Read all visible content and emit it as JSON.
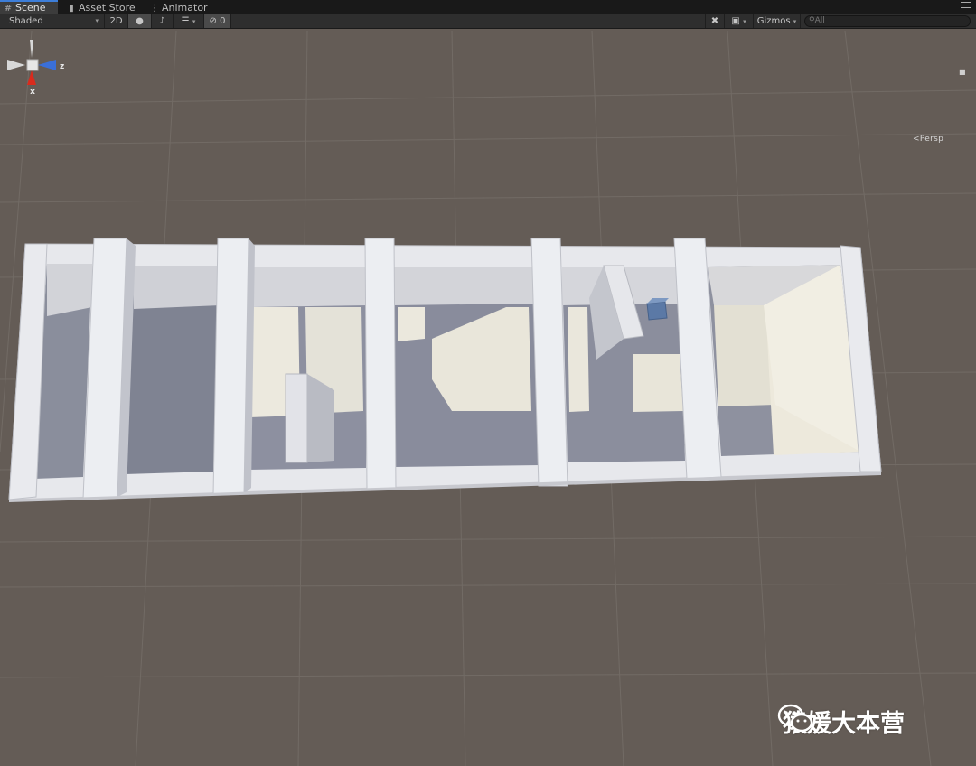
{
  "tabs": [
    {
      "label": "Scene",
      "icon": "grid-icon",
      "active": true
    },
    {
      "label": "Asset Store",
      "icon": "bag-icon",
      "active": false
    },
    {
      "label": "Animator",
      "icon": "animator-icon",
      "active": false
    }
  ],
  "toolbar": {
    "draw_mode": "Shaded",
    "mode_2d": "2D",
    "hidden_count": "0",
    "gizmos": "Gizmos",
    "search_placeholder": "All"
  },
  "gizmo": {
    "axis_x": "x",
    "axis_z": "z",
    "projection": "Persp"
  },
  "watermark": {
    "text": "猿媛大本营",
    "icon": "wechat-icon"
  },
  "colors": {
    "viewport_bg": "#645c56",
    "grid_line": "#766f69",
    "wall_top": "#e9eaee",
    "floor_shadow": "#7f8392",
    "floor_lit": "#ece9de",
    "tab_accent": "#3d7ed9",
    "axis_x": "#d92b1d",
    "axis_z": "#3a6fd8"
  }
}
